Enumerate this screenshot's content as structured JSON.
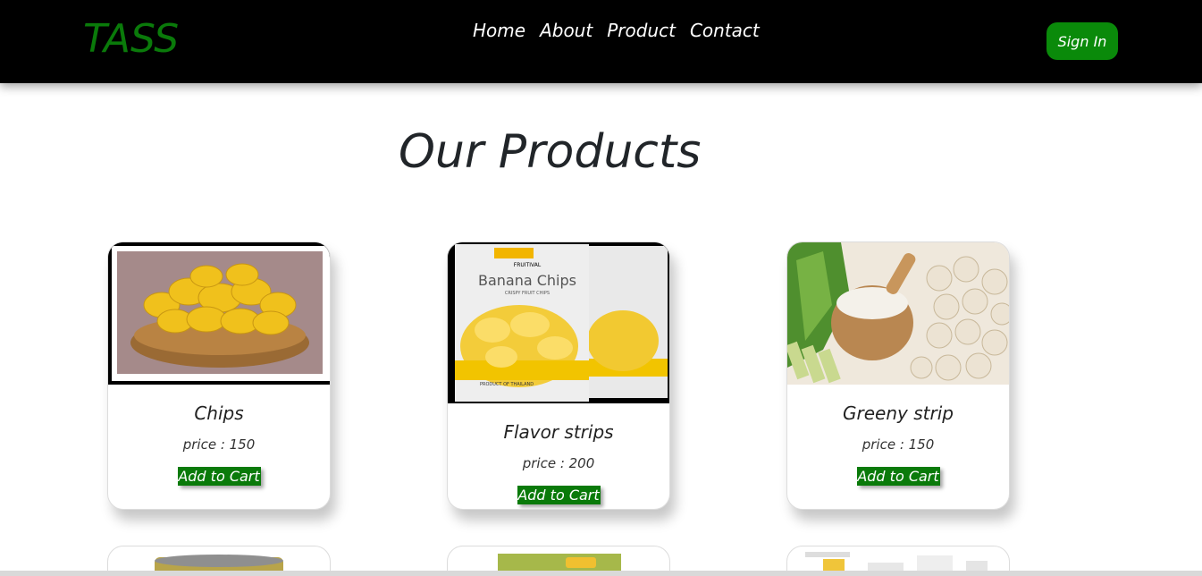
{
  "navbar": {
    "brand": "TASS",
    "links": [
      "Home",
      "About",
      "Product",
      "Contact"
    ],
    "signin_label": "Sign In"
  },
  "products_section": {
    "title": "Our Products"
  },
  "products": [
    {
      "name": "Chips",
      "price": "price : 150",
      "cart_label": "Add to Cart",
      "image": "banana-chips-basket"
    },
    {
      "name": "Flavor strips",
      "price": "price : 200",
      "cart_label": "Add to Cart",
      "image": "banana-chips-packs"
    },
    {
      "name": "Greeny strip",
      "price": "price : 150",
      "cart_label": "Add to Cart",
      "image": "banana-flour-bowl"
    }
  ],
  "pack_text": {
    "brand": "FRUITIVAL",
    "title": "Banana Chips",
    "subtitle": "CRISPY FRUIT CHIPS",
    "origin": "PRODUCT OF THAILAND"
  },
  "colors": {
    "brand_green": "#0a7a0a",
    "navbar_bg": "#000000",
    "title_text": "#212529"
  }
}
